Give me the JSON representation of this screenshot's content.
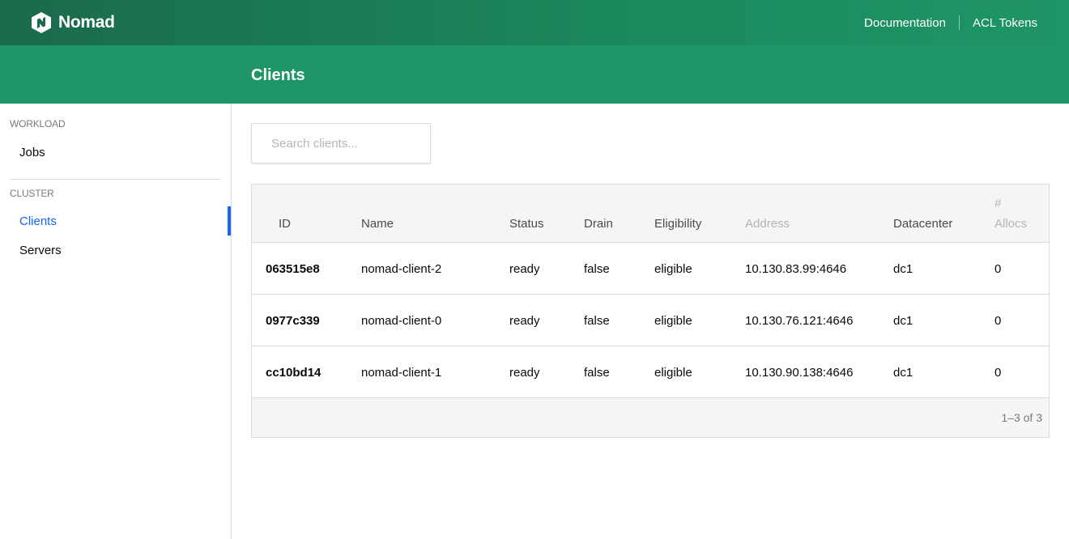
{
  "app": {
    "name": "Nomad",
    "logo_icon": "nomad-hexagon-icon",
    "colors": {
      "header": "#1b8a5d",
      "subheader": "#1d9566",
      "active": "#1563ff"
    }
  },
  "topnav": {
    "documentation": "Documentation",
    "acl_tokens": "ACL Tokens"
  },
  "page": {
    "title": "Clients"
  },
  "sidebar": {
    "sections": [
      {
        "label": "WORKLOAD",
        "items": [
          {
            "label": "Jobs",
            "active": false
          }
        ]
      },
      {
        "label": "CLUSTER",
        "items": [
          {
            "label": "Clients",
            "active": true
          },
          {
            "label": "Servers",
            "active": false
          }
        ]
      }
    ]
  },
  "search": {
    "placeholder": "Search clients..."
  },
  "table": {
    "columns": [
      "ID",
      "Name",
      "Status",
      "Drain",
      "Eligibility",
      "Address",
      "Datacenter",
      "#",
      "Allocs"
    ],
    "rows": [
      {
        "id": "063515e8",
        "name": "nomad-client-2",
        "status": "ready",
        "drain": "false",
        "eligibility": "eligible",
        "address": "10.130.83.99:4646",
        "datacenter": "dc1",
        "allocs": "0"
      },
      {
        "id": "0977c339",
        "name": "nomad-client-0",
        "status": "ready",
        "drain": "false",
        "eligibility": "eligible",
        "address": "10.130.76.121:4646",
        "datacenter": "dc1",
        "allocs": "0"
      },
      {
        "id": "cc10bd14",
        "name": "nomad-client-1",
        "status": "ready",
        "drain": "false",
        "eligibility": "eligible",
        "address": "10.130.90.138:4646",
        "datacenter": "dc1",
        "allocs": "0"
      }
    ],
    "pagination": "1–3 of 3"
  }
}
